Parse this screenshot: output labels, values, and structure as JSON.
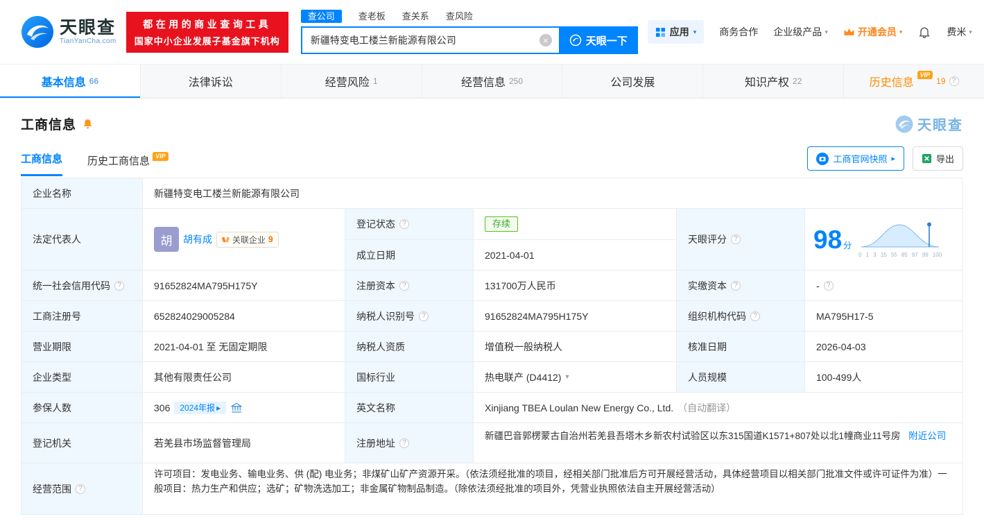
{
  "misc": {
    "help_glyph": "?",
    "clear_glyph": "×",
    "caret": "▾",
    "arrow": "▸",
    "vip": "VIP"
  },
  "brand": {
    "name": "天眼查",
    "domain": "TianYanCha.com",
    "banner_line1": "都在用的商业查询工具",
    "banner_line2": "国家中小企业发展子基金旗下机构",
    "primary_color": "#0084ff",
    "banner_color": "#e8121f",
    "vip_color": "#ff8a00"
  },
  "search": {
    "tabs": [
      {
        "label": "查公司"
      },
      {
        "label": "查老板"
      },
      {
        "label": "查关系"
      },
      {
        "label": "查风险"
      }
    ],
    "value": "新疆特变电工楼兰新能源有限公司",
    "submit_label": "天眼一下"
  },
  "topnav": {
    "apps": "应用",
    "cooperation": "商务合作",
    "enterprise": "企业级产品",
    "vip": "开通会员",
    "user": "费米"
  },
  "tabs": [
    {
      "label": "基本信息",
      "count": "66"
    },
    {
      "label": "法律诉讼",
      "count": ""
    },
    {
      "label": "经营风险",
      "count": "1"
    },
    {
      "label": "经营信息",
      "count": "250"
    },
    {
      "label": "公司发展",
      "count": ""
    },
    {
      "label": "知识产权",
      "count": "22"
    },
    {
      "label": "历史信息",
      "count": "19"
    }
  ],
  "section": {
    "title": "工商信息",
    "subtab_current": "工商信息",
    "subtab_history": "历史工商信息",
    "snapshot_button": "工商官网快照",
    "export_button": "导出",
    "watermark": "天眼查"
  },
  "fields": {
    "company_name": {
      "label": "企业名称",
      "value": "新疆特变电工楼兰新能源有限公司"
    },
    "legal_rep": {
      "label": "法定代表人",
      "avatar": "胡",
      "name": "胡有成",
      "related_label": "关联企业",
      "related_count": "9"
    },
    "reg_status": {
      "label": "登记状态",
      "value": "存续"
    },
    "establish_date": {
      "label": "成立日期",
      "value": "2021-04-01"
    },
    "score": {
      "label": "天眼评分",
      "value": "98",
      "unit": "分",
      "ticks": [
        "0",
        "1",
        "3",
        "15",
        "55",
        "85",
        "97",
        "99",
        "100"
      ]
    },
    "credit_code": {
      "label": "统一社会信用代码",
      "value": "91652824MA795H175Y"
    },
    "reg_capital": {
      "label": "注册资本",
      "value": "131700万人民币"
    },
    "paid_capital": {
      "label": "实缴资本",
      "value": "-"
    },
    "reg_number": {
      "label": "工商注册号",
      "value": "652824029005284"
    },
    "taxpayer_id": {
      "label": "纳税人识别号",
      "value": "91652824MA795H175Y"
    },
    "org_code": {
      "label": "组织机构代码",
      "value": "MA795H17-5"
    },
    "business_term": {
      "label": "营业期限",
      "value": "2021-04-01 至 无固定期限"
    },
    "taxpayer_quality": {
      "label": "纳税人资质",
      "value": "增值税一般纳税人"
    },
    "approval_date": {
      "label": "核准日期",
      "value": "2026-04-03"
    },
    "company_type": {
      "label": "企业类型",
      "value": "其他有限责任公司"
    },
    "industry": {
      "label": "国标行业",
      "value": "热电联产 (D4412)"
    },
    "staff_size": {
      "label": "人员规模",
      "value": "100-499人"
    },
    "insured_count": {
      "label": "参保人数",
      "value": "306",
      "report_badge": "2024年报"
    },
    "english_name": {
      "label": "英文名称",
      "value": "Xinjiang TBEA Loulan New Energy Co., Ltd.",
      "note": "（自动翻译）"
    },
    "reg_authority": {
      "label": "登记机关",
      "value": "若羌县市场监督管理局"
    },
    "reg_address": {
      "label": "注册地址",
      "value": "新疆巴音郭楞蒙古自治州若羌县吾塔木乡新农村试验区以东315国道K1571+807处以北1幢商业11号房",
      "nearby_link": "附近公司"
    },
    "business_scope": {
      "label": "经营范围",
      "value": "许可项目：发电业务、输电业务、供 (配) 电业务；非煤矿山矿产资源开采。（依法须经批准的项目，经相关部门批准后方可开展经营活动，具体经营项目以相关部门批准文件或许可证件为准）一般项目：热力生产和供应；选矿；矿物洗选加工；非金属矿物制品制造。（除依法须经批准的项目外，凭营业执照依法自主开展经营活动）"
    }
  }
}
